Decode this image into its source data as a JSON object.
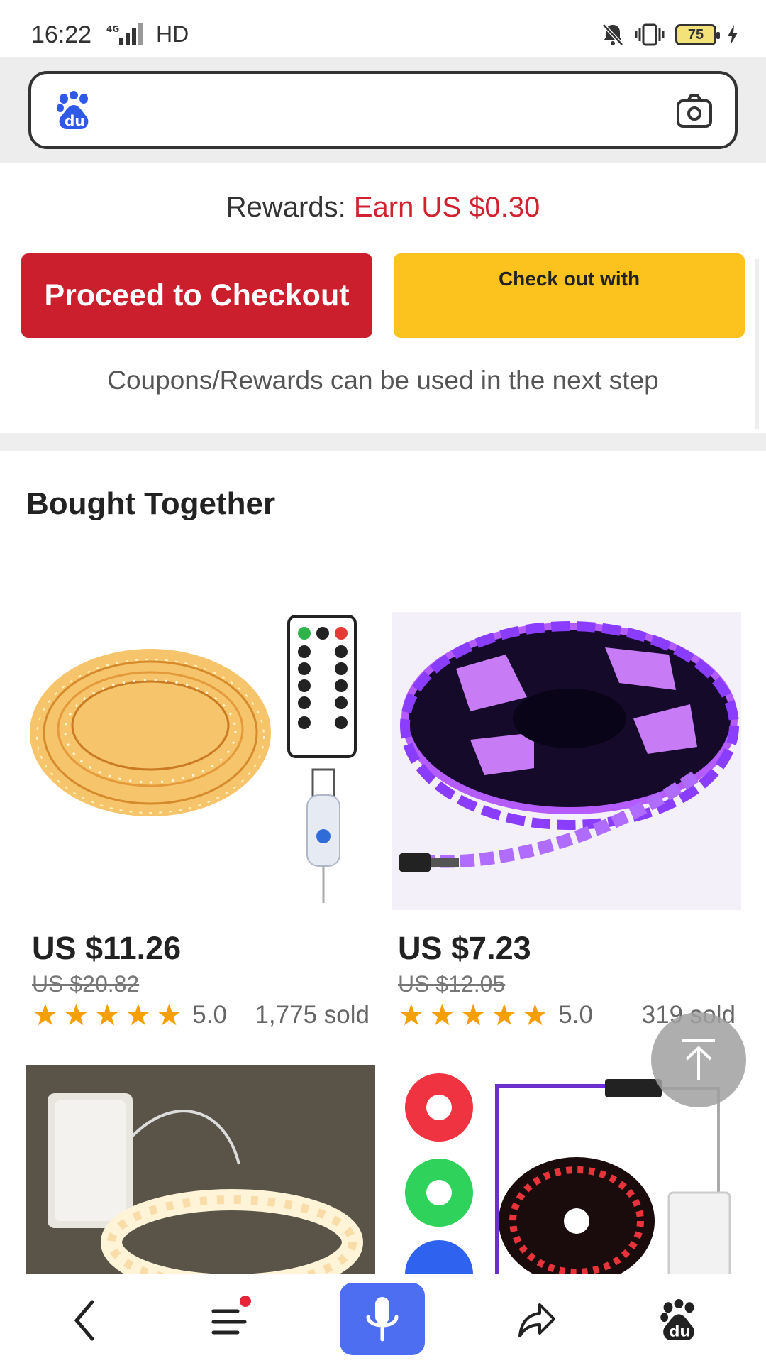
{
  "status": {
    "time": "16:22",
    "network": "4G",
    "hd": "HD",
    "battery": "75"
  },
  "search": {
    "placeholder": ""
  },
  "rewards": {
    "label": "Rewards: ",
    "value": "Earn US $0.30"
  },
  "buttons": {
    "checkout": "Proceed to Checkout",
    "paypal": "Check out with"
  },
  "coupon_note": "Coupons/Rewards can be used in the next step",
  "section_title": "Bought Together",
  "products": [
    {
      "price": "US $11.26",
      "original": "US $20.82",
      "rating": "5.0",
      "sold": "1,775 sold"
    },
    {
      "price": "US $7.23",
      "original": "US $12.05",
      "rating": "5.0",
      "sold": "319 sold"
    }
  ],
  "colors": {
    "accent_red": "#cc1f2d",
    "paypal_yellow": "#fcc21e",
    "star": "#f5a000",
    "baidu_blue": "#4e6ef2"
  },
  "icons": [
    "baidu-logo-icon",
    "camera-icon",
    "back-to-top-icon",
    "back-icon",
    "menu-icon",
    "mic-icon",
    "share-icon",
    "baidu-paw-icon"
  ]
}
